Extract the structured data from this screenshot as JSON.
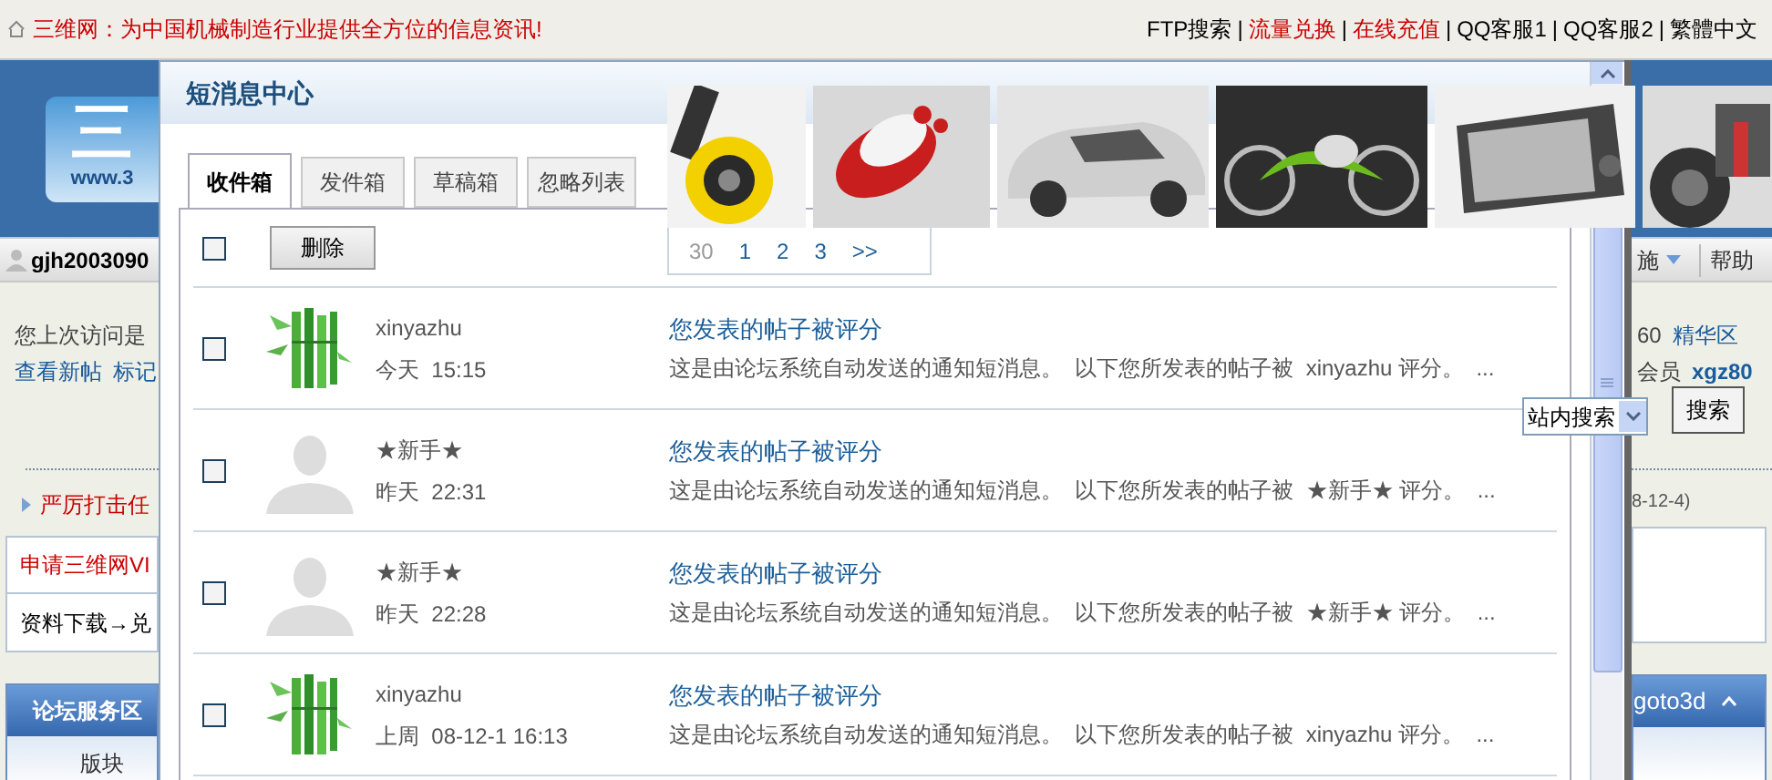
{
  "top_bar": {
    "slogan": "三维网：为中国机械制造行业提供全方位的信息资讯!",
    "links": [
      {
        "kind": "link",
        "text": "FTP搜索",
        "hot": false
      },
      {
        "kind": "separator",
        "text": "|"
      },
      {
        "kind": "link",
        "text": "流量兑换",
        "hot": true
      },
      {
        "kind": "separator",
        "text": "|"
      },
      {
        "kind": "link",
        "text": "在线充值",
        "hot": true
      },
      {
        "kind": "separator",
        "text": "|"
      },
      {
        "kind": "link",
        "text": "QQ客服1",
        "hot": false
      },
      {
        "kind": "separator",
        "text": "|"
      },
      {
        "kind": "link",
        "text": "QQ客服2",
        "hot": false
      },
      {
        "kind": "separator",
        "text": "|"
      },
      {
        "kind": "link",
        "text": "繁體中文",
        "hot": false
      }
    ]
  },
  "logo": {
    "text": "三",
    "url": "www.3"
  },
  "user_bar": {
    "username": "gjh2003090",
    "menu_fragment": "施",
    "help": "帮助"
  },
  "left_panel": {
    "last_visit": "您上次访问是",
    "links": [
      "查看新帖",
      "标记"
    ],
    "notice": "严厉打击任",
    "box_rows": [
      "申请三维网VI",
      "资料下载→兑"
    ],
    "section_title": "论坛服务区",
    "column": "版块"
  },
  "right_panel": {
    "stats": [
      {
        "value": "60",
        "link": "精华区"
      },
      {
        "value": "会员",
        "link": "xgz80"
      }
    ],
    "search_scope": "站内搜索",
    "search_button": "搜索",
    "date": "8-12-4)",
    "section_title": "goto3d"
  },
  "dialog": {
    "title": "短消息中心",
    "tabs": [
      {
        "label": "收件箱",
        "selected": true
      },
      {
        "label": "发件箱",
        "selected": false
      },
      {
        "label": "草稿箱",
        "selected": false
      },
      {
        "label": "忽略列表",
        "selected": false
      }
    ],
    "select_all": {
      "checked": false
    },
    "delete_button": "删除",
    "messages": [
      {
        "checked": false,
        "kind": "bamboo",
        "sender": "xinyazhu",
        "time": "今天  15:15",
        "subject": "您发表的帖子被评分",
        "summary": "这是由论坛系统自动发送的通知短消息。  以下您所发表的帖子被  xinyazhu 评分。  ..."
      },
      {
        "checked": false,
        "kind": "silhouette",
        "sender": "★新手★",
        "time": "昨天  22:31",
        "subject": "您发表的帖子被评分",
        "summary": "这是由论坛系统自动发送的通知短消息。  以下您所发表的帖子被  ★新手★ 评分。  ..."
      },
      {
        "checked": false,
        "kind": "silhouette",
        "sender": "★新手★",
        "time": "昨天  22:28",
        "subject": "您发表的帖子被评分",
        "summary": "这是由论坛系统自动发送的通知短消息。  以下您所发表的帖子被  ★新手★ 评分。  ..."
      },
      {
        "checked": false,
        "kind": "bamboo",
        "sender": "xinyazhu",
        "time": "上周  08-12-1 16:13",
        "subject": "您发表的帖子被评分",
        "summary": "这是由论坛系统自动发送的通知短消息。  以下您所发表的帖子被  xinyazhu 评分。  ..."
      }
    ]
  },
  "gallery": {
    "pager": [
      {
        "label": "30",
        "selected": true
      },
      {
        "label": "1",
        "selected": false
      },
      {
        "label": "2",
        "selected": false
      },
      {
        "label": "3",
        "selected": false
      },
      {
        "label": ">>",
        "selected": false
      }
    ]
  }
}
